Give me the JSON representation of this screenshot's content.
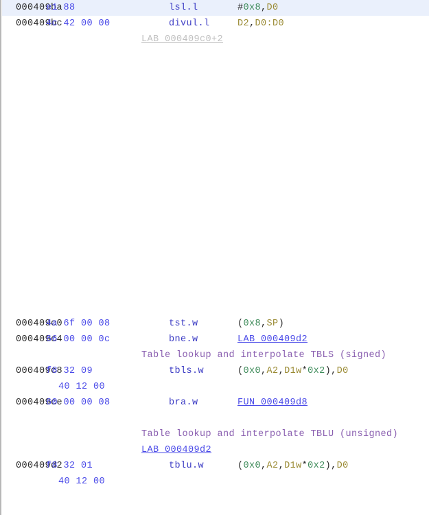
{
  "view": {
    "name": "disassembly-listing",
    "colors": {
      "background": "#ffffff",
      "selected_row": "#eaf0fc",
      "address": "#2b2b2b",
      "bytes": "#4a4ae8",
      "mnemonic": "#3b3bc4",
      "reference": "#4a4ae8",
      "comment": "#8a5fb0",
      "number_operand": "#3c8a58",
      "register_operand": "#9a8a33",
      "faint_label": "#c0c0c0",
      "left_border": "#b7b7b7"
    }
  },
  "lines": [
    {
      "kind": "instruction",
      "selected": true,
      "address": "000409ba",
      "bytes": "e1 88",
      "mnemonic": "lsl.l",
      "operand_tokens": [
        {
          "text": "#",
          "type": "punct"
        },
        {
          "text": "0x8",
          "type": "num"
        },
        {
          "text": ",",
          "type": "punct"
        },
        {
          "text": "D0",
          "type": "reg"
        }
      ],
      "operands_plain": "#0x8,D0"
    },
    {
      "kind": "instruction",
      "selected": false,
      "address": "000409bc",
      "bytes": "4c 42 00 00",
      "mnemonic": "divul.l",
      "operand_tokens": [
        {
          "text": "D2",
          "type": "reg"
        },
        {
          "text": ",",
          "type": "punct"
        },
        {
          "text": "D0:D0",
          "type": "reg"
        }
      ],
      "operands_plain": "D2,D0:D0"
    },
    {
      "kind": "label-faint",
      "label": "LAB_000409c0+2"
    },
    {
      "kind": "blank"
    },
    {
      "kind": "blank"
    },
    {
      "kind": "blank"
    },
    {
      "kind": "blank"
    },
    {
      "kind": "blank"
    },
    {
      "kind": "blank"
    },
    {
      "kind": "blank"
    },
    {
      "kind": "blank"
    },
    {
      "kind": "blank"
    },
    {
      "kind": "blank"
    },
    {
      "kind": "blank"
    },
    {
      "kind": "blank"
    },
    {
      "kind": "blank"
    },
    {
      "kind": "blank"
    },
    {
      "kind": "blank"
    },
    {
      "kind": "blank"
    },
    {
      "kind": "blank"
    },
    {
      "kind": "instruction",
      "selected": false,
      "address": "000409c0",
      "bytes": "4a 6f 00 08",
      "mnemonic": "tst.w",
      "operand_tokens": [
        {
          "text": "(",
          "type": "punct"
        },
        {
          "text": "0x8",
          "type": "num"
        },
        {
          "text": ",",
          "type": "punct"
        },
        {
          "text": "SP",
          "type": "reg"
        },
        {
          "text": ")",
          "type": "punct"
        }
      ],
      "operands_plain": "(0x8,SP)"
    },
    {
      "kind": "instruction",
      "selected": false,
      "address": "000409c4",
      "bytes": "66 00 00 0c",
      "mnemonic": "bne.w",
      "operand_tokens": [
        {
          "text": "LAB_000409d2",
          "type": "ref"
        }
      ],
      "operands_plain": "LAB_000409d2"
    },
    {
      "kind": "comment",
      "comment": "Table lookup and interpolate TBLS (signed)"
    },
    {
      "kind": "instruction",
      "selected": false,
      "address": "000409c8",
      "bytes": "f8 32 09",
      "mnemonic": "tbls.w",
      "operand_tokens": [
        {
          "text": "(",
          "type": "punct"
        },
        {
          "text": "0x0",
          "type": "num"
        },
        {
          "text": ",",
          "type": "punct"
        },
        {
          "text": "A2",
          "type": "reg"
        },
        {
          "text": ",",
          "type": "punct"
        },
        {
          "text": "D1w",
          "type": "reg"
        },
        {
          "text": "*",
          "type": "punct"
        },
        {
          "text": "0x2",
          "type": "num"
        },
        {
          "text": ")",
          "type": "punct"
        },
        {
          "text": ",",
          "type": "punct"
        },
        {
          "text": "D0",
          "type": "reg"
        }
      ],
      "operands_plain": "(0x0,A2,D1w*0x2),D0"
    },
    {
      "kind": "bytes-continuation",
      "bytes": "40 12 00"
    },
    {
      "kind": "instruction",
      "selected": false,
      "address": "000409ce",
      "bytes": "60 00 00 08",
      "mnemonic": "bra.w",
      "operand_tokens": [
        {
          "text": "FUN_000409d8",
          "type": "ref"
        }
      ],
      "operands_plain": "FUN_000409d8"
    },
    {
      "kind": "blank"
    },
    {
      "kind": "comment",
      "comment": "Table lookup and interpolate TBLU (unsigned)"
    },
    {
      "kind": "label-link",
      "label": "LAB_000409d2"
    },
    {
      "kind": "instruction",
      "selected": false,
      "address": "000409d2",
      "bytes": "f8 32 01",
      "mnemonic": "tblu.w",
      "operand_tokens": [
        {
          "text": "(",
          "type": "punct"
        },
        {
          "text": "0x0",
          "type": "num"
        },
        {
          "text": ",",
          "type": "punct"
        },
        {
          "text": "A2",
          "type": "reg"
        },
        {
          "text": ",",
          "type": "punct"
        },
        {
          "text": "D1w",
          "type": "reg"
        },
        {
          "text": "*",
          "type": "punct"
        },
        {
          "text": "0x2",
          "type": "num"
        },
        {
          "text": ")",
          "type": "punct"
        },
        {
          "text": ",",
          "type": "punct"
        },
        {
          "text": "D0",
          "type": "reg"
        }
      ],
      "operands_plain": "(0x0,A2,D1w*0x2),D0"
    },
    {
      "kind": "bytes-continuation",
      "bytes": "40 12 00"
    }
  ]
}
